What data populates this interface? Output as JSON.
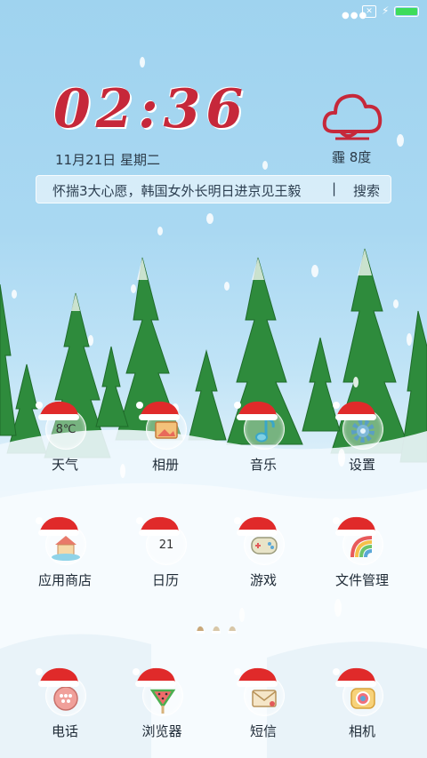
{
  "status_bar": {
    "signal_icon": "signal-dots-icon",
    "sim_icon": "no-sim-icon",
    "sim_glyph": "✕",
    "charging_icon": "bolt-icon",
    "battery_color": "#3ddc5a",
    "battery_level": 1.0
  },
  "clock": {
    "time": "02:36",
    "date": "11月21日 星期二"
  },
  "weather_widget": {
    "icon": "cloud-outline-icon",
    "text": "霾 8度",
    "color": "#c6283a"
  },
  "search": {
    "query": "怀揣3大心愿，韩国女外长明日进京见王毅",
    "divider": "|",
    "button": "搜索"
  },
  "apps_row1": [
    {
      "label": "天气",
      "icon": "weather-icon",
      "badge": "8℃"
    },
    {
      "label": "相册",
      "icon": "gallery-icon"
    },
    {
      "label": "音乐",
      "icon": "music-note-icon"
    },
    {
      "label": "设置",
      "icon": "gear-icon"
    }
  ],
  "apps_row2": [
    {
      "label": "应用商店",
      "icon": "app-store-house-icon"
    },
    {
      "label": "日历",
      "icon": "calendar-icon",
      "badge": "21"
    },
    {
      "label": "游戏",
      "icon": "gamepad-icon"
    },
    {
      "label": "文件管理",
      "icon": "rainbow-folder-icon"
    }
  ],
  "dock": [
    {
      "label": "电话",
      "icon": "phone-icon"
    },
    {
      "label": "浏览器",
      "icon": "watermelon-popsicle-icon"
    },
    {
      "label": "短信",
      "icon": "envelope-icon"
    },
    {
      "label": "相机",
      "icon": "camera-icon"
    }
  ],
  "pager": {
    "pages": 3,
    "current": 1
  },
  "colors": {
    "hat_red": "#e02a2a",
    "clock_red": "#c6283a",
    "sky": "#a9d8f2",
    "tree_green": "#2f8a3a"
  }
}
